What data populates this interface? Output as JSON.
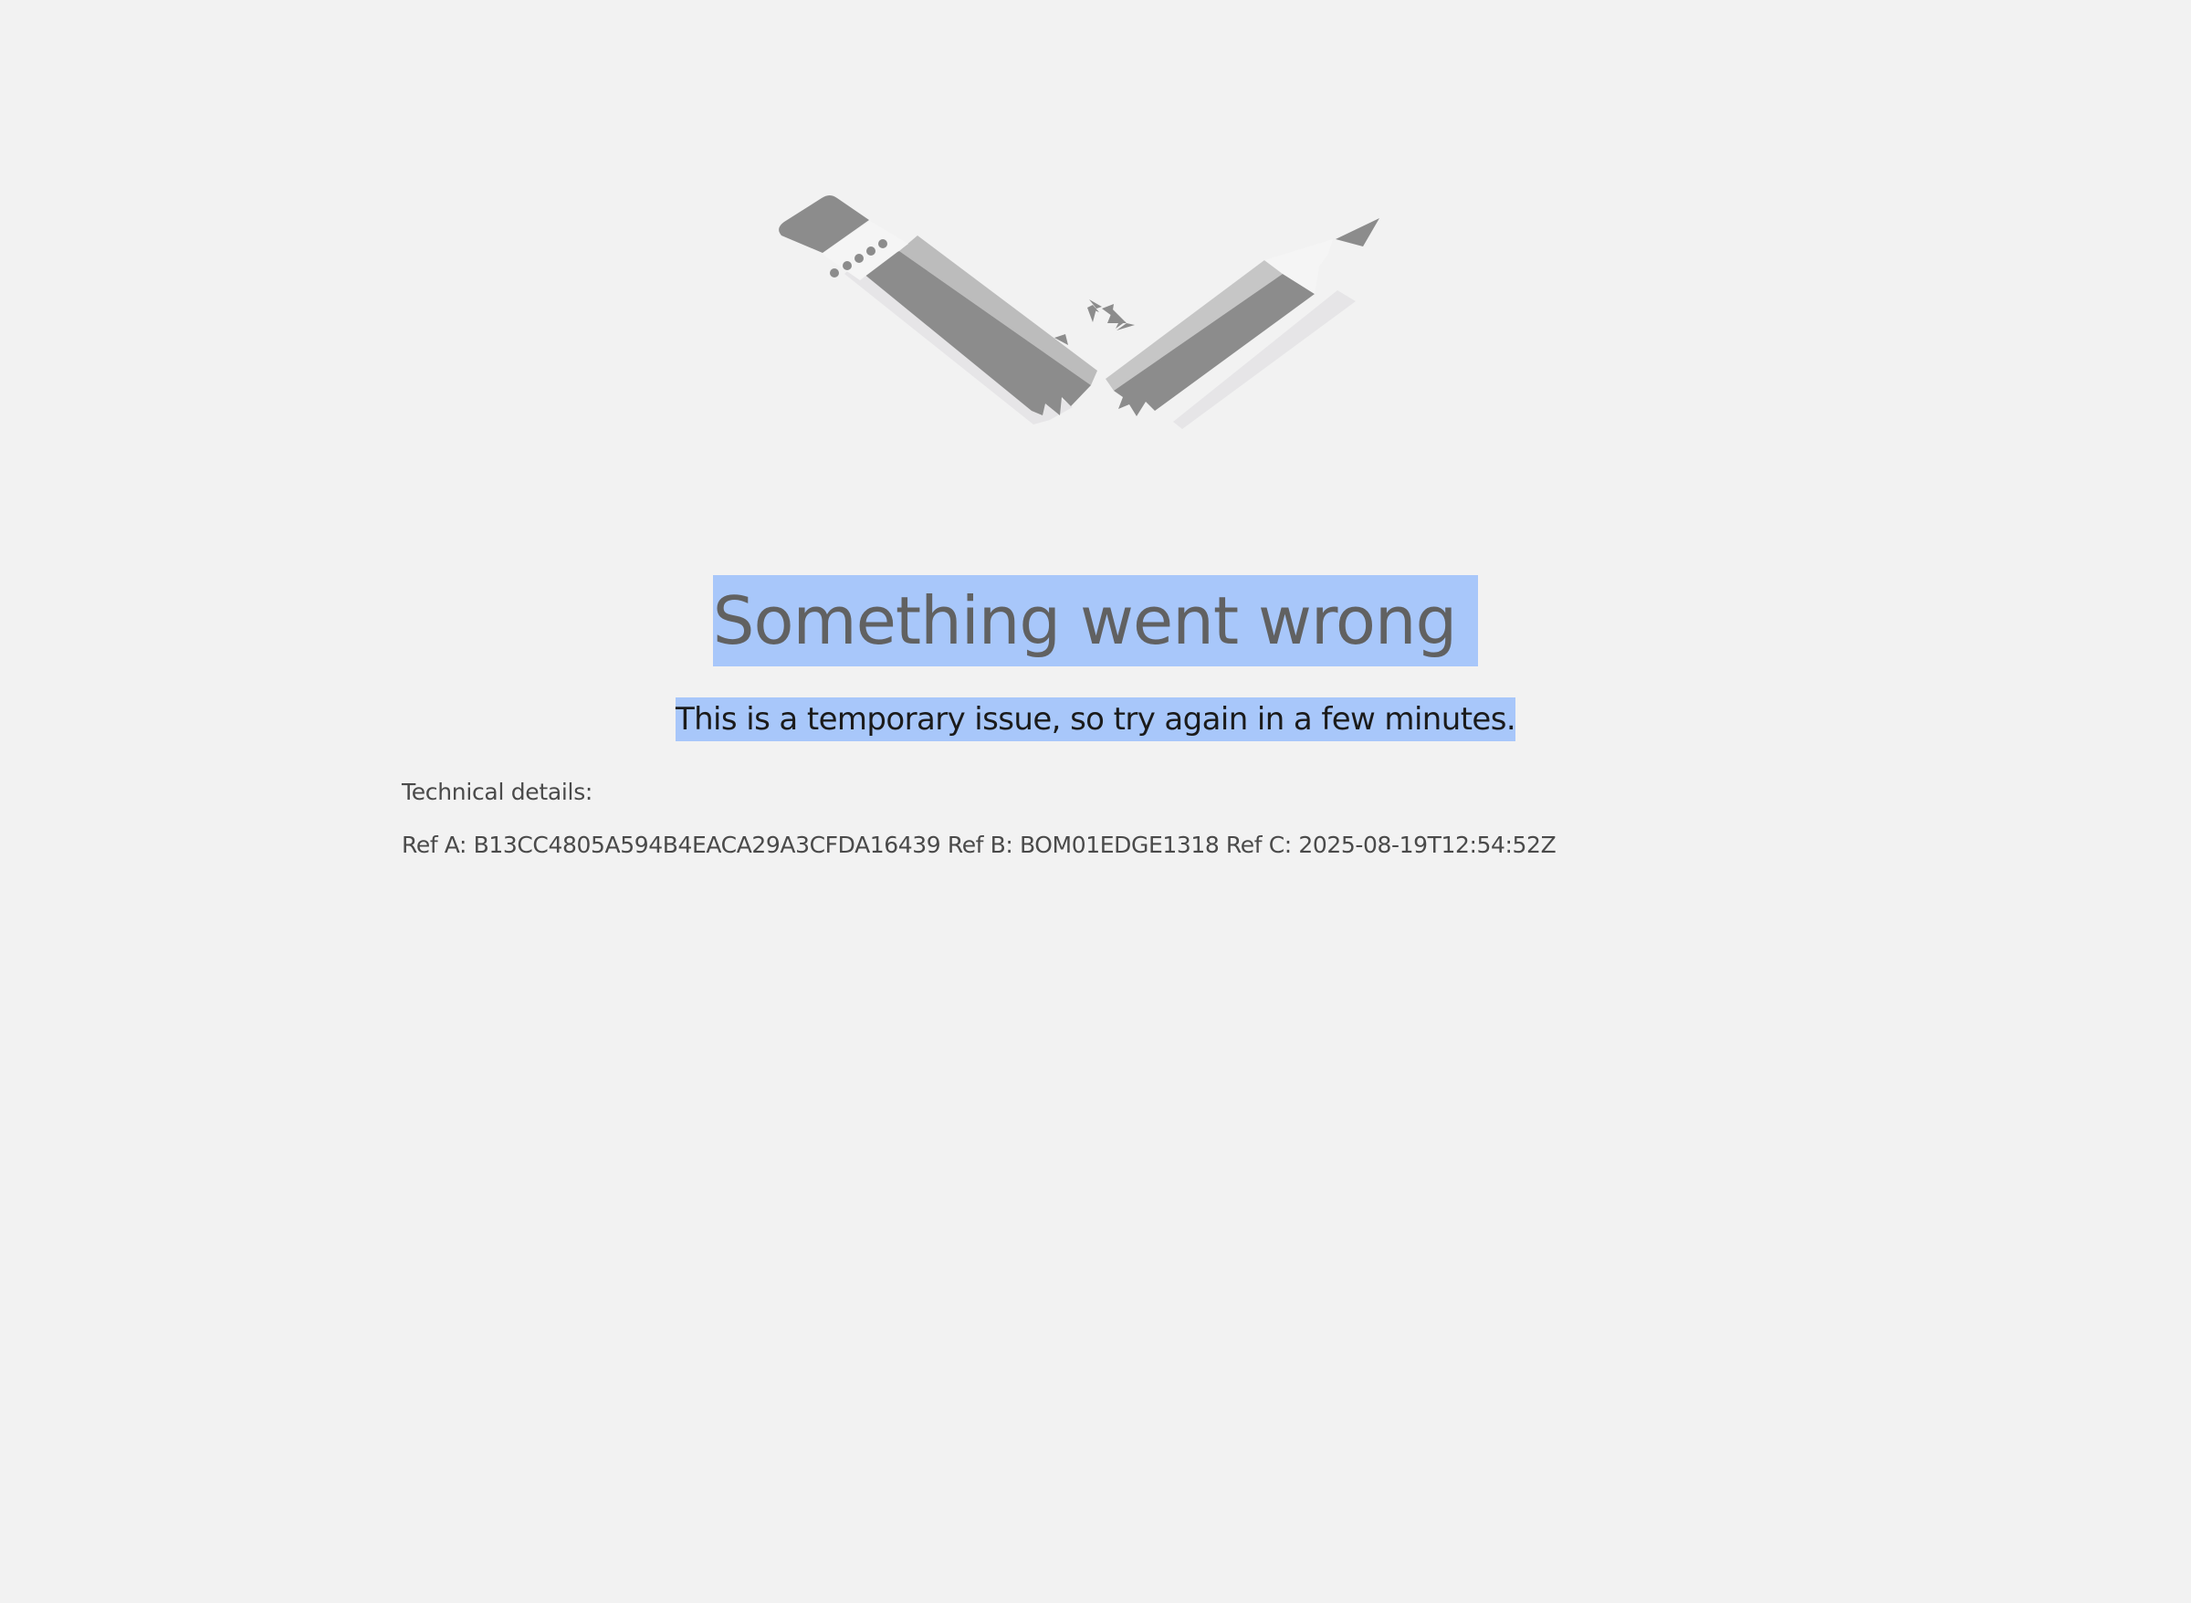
{
  "page": {
    "heading": "Something went wrong",
    "message": "This is a temporary issue, so try again in a few minutes.",
    "technical_details_label": "Technical details:",
    "references": {
      "ref_a_label": "Ref A:",
      "ref_a_value": "B13CC4805A594B4EACA29A3CFDA16439",
      "ref_b_label": "Ref B:",
      "ref_b_value": "BOM01EDGE1318",
      "ref_c_label": "Ref C:",
      "ref_c_value": "2025-08-19T12:54:52Z"
    }
  },
  "illustration": {
    "icon": "broken-pencil-icon"
  },
  "colors": {
    "background": "#f2f2f2",
    "selection_highlight": "#a8c7fa",
    "heading_text": "#616161",
    "message_text": "#1b1b1b",
    "details_text": "#4a4a4a"
  }
}
